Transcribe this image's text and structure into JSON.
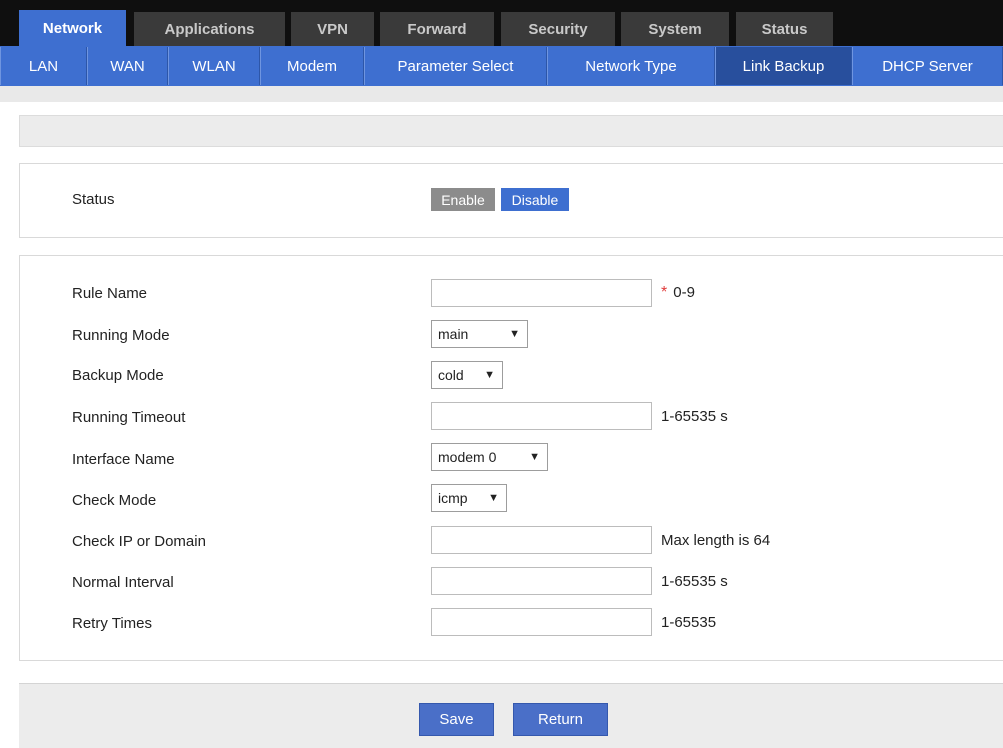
{
  "top_tabs": [
    "Network",
    "Applications",
    "VPN",
    "Forward",
    "Security",
    "System",
    "Status"
  ],
  "sub_tabs": [
    "LAN",
    "WAN",
    "WLAN",
    "Modem",
    "Parameter Select",
    "Network Type",
    "Link Backup",
    "DHCP Server"
  ],
  "status": {
    "label": "Status",
    "enable_label": "Enable",
    "disable_label": "Disable"
  },
  "form": {
    "rule_name": {
      "label": "Rule Name",
      "value": "",
      "hint": "0-9",
      "required_mark": "*"
    },
    "running_mode": {
      "label": "Running Mode",
      "value": "main"
    },
    "backup_mode": {
      "label": "Backup Mode",
      "value": "cold"
    },
    "running_timeout": {
      "label": "Running Timeout",
      "value": "",
      "hint": "1-65535 s"
    },
    "interface_name": {
      "label": "Interface Name",
      "value": "modem 0"
    },
    "check_mode": {
      "label": "Check Mode",
      "value": "icmp"
    },
    "check_ip": {
      "label": "Check IP or Domain",
      "value": "",
      "hint": "Max length is 64"
    },
    "normal_interval": {
      "label": "Normal Interval",
      "value": "",
      "hint": "1-65535 s"
    },
    "retry_times": {
      "label": "Retry Times",
      "value": "",
      "hint": "1-65535"
    }
  },
  "buttons": {
    "save": "Save",
    "return": "Return"
  },
  "colors": {
    "accent": "#3e6fd0",
    "active_subtab": "#284f9d",
    "enable_grey": "#8c8c8c",
    "required_red": "#e03b3b"
  }
}
